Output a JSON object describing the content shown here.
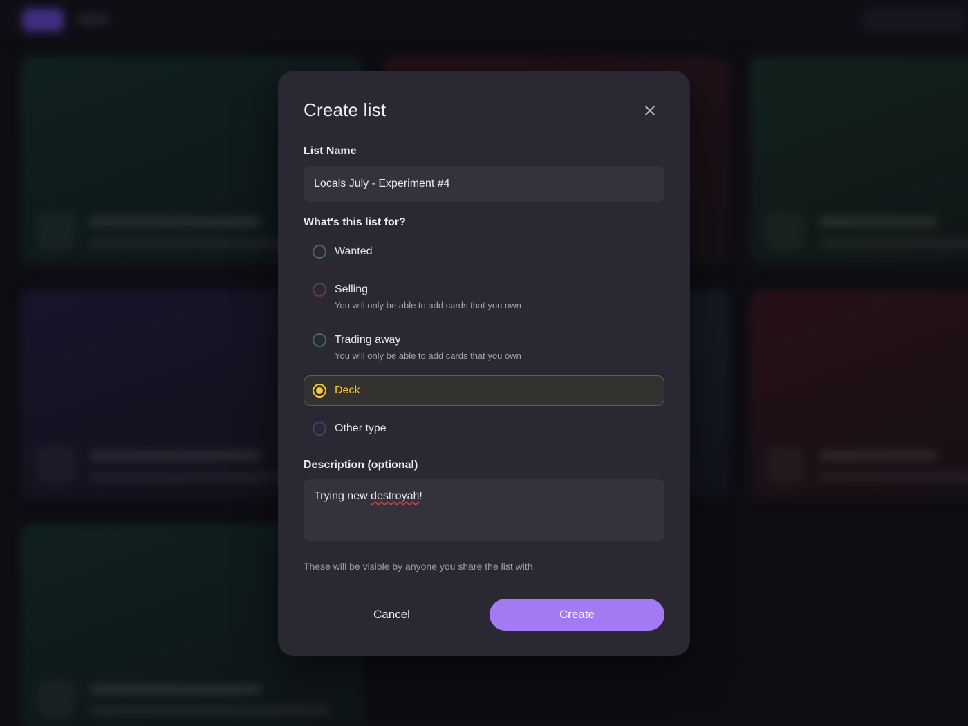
{
  "modal": {
    "title": "Create list",
    "list_name_label": "List Name",
    "list_name_value": "Locals July - Experiment #4",
    "purpose_label": "What's this list for?",
    "options": [
      {
        "label": "Wanted",
        "sub": "",
        "selected": false,
        "ring_color": "#3d6b70"
      },
      {
        "label": "Selling",
        "sub": "You will only be able to add cards that you own",
        "selected": false,
        "ring_color": "#7a3344"
      },
      {
        "label": "Trading away",
        "sub": "You will only be able to add cards that you own",
        "selected": false,
        "ring_color": "#3d6b70"
      },
      {
        "label": "Deck",
        "sub": "",
        "selected": true,
        "ring_color": "#f5c93c"
      },
      {
        "label": "Other type",
        "sub": "",
        "selected": false,
        "ring_color": "#4a3f70"
      }
    ],
    "description_label": "Description (optional)",
    "description_prefix": "Trying new ",
    "description_misspelled": "destroyah",
    "description_suffix": "!",
    "hint": "These will be visible by anyone you share the list with.",
    "cancel_label": "Cancel",
    "create_label": "Create",
    "accent_color": "#a27bf4",
    "selected_color": "#f5c93c",
    "close_icon": "close-icon"
  }
}
